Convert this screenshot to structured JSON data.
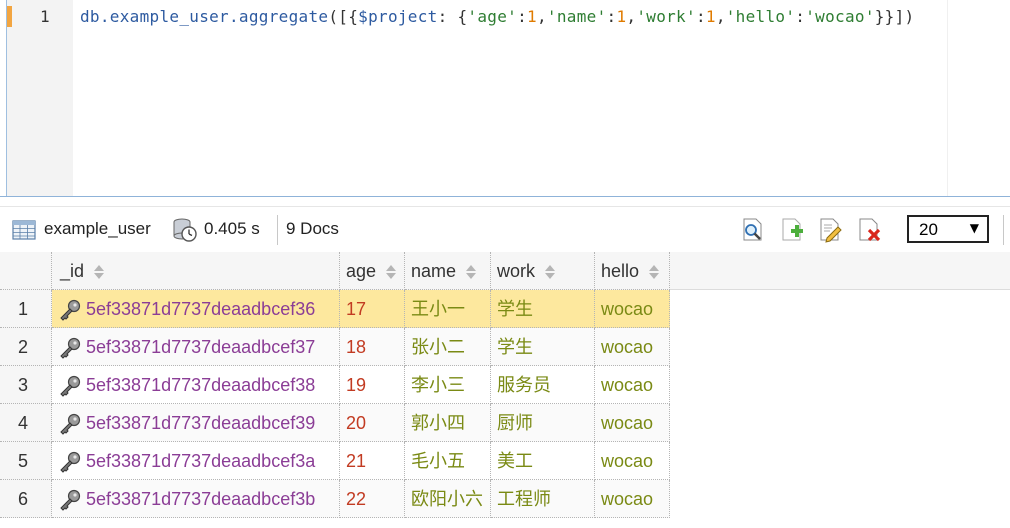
{
  "editor": {
    "line_number": "1",
    "code_tokens": [
      {
        "t": "db.example_user.aggregate",
        "c": "tk-default"
      },
      {
        "t": "([{",
        "c": "tk-punc"
      },
      {
        "t": "$project",
        "c": "tk-default"
      },
      {
        "t": ": {",
        "c": "tk-punc"
      },
      {
        "t": "'age'",
        "c": "tk-str"
      },
      {
        "t": ":",
        "c": "tk-punc"
      },
      {
        "t": "1",
        "c": "tk-num"
      },
      {
        "t": ",",
        "c": "tk-punc"
      },
      {
        "t": "'name'",
        "c": "tk-str"
      },
      {
        "t": ":",
        "c": "tk-punc"
      },
      {
        "t": "1",
        "c": "tk-num"
      },
      {
        "t": ",",
        "c": "tk-punc"
      },
      {
        "t": "'work'",
        "c": "tk-str"
      },
      {
        "t": ":",
        "c": "tk-punc"
      },
      {
        "t": "1",
        "c": "tk-num"
      },
      {
        "t": ",",
        "c": "tk-punc"
      },
      {
        "t": "'hello'",
        "c": "tk-str"
      },
      {
        "t": ":",
        "c": "tk-punc"
      },
      {
        "t": "'wocao'",
        "c": "tk-str"
      },
      {
        "t": "}}])",
        "c": "tk-punc"
      }
    ]
  },
  "toolbar": {
    "collection": "example_user",
    "time": "0.405 s",
    "docs": "9 Docs",
    "page_size": "20",
    "icons": [
      "table-icon",
      "timer-icon",
      "find-icon",
      "add-document-icon",
      "edit-document-icon",
      "delete-document-icon"
    ]
  },
  "grid": {
    "headers": {
      "id": "_id",
      "age": "age",
      "name": "name",
      "work": "work",
      "hello": "hello"
    },
    "rows": [
      {
        "num": "1",
        "id": "5ef33871d7737deaadbcef36",
        "age": "17",
        "name": "王小一",
        "work": "学生",
        "hello": "wocao"
      },
      {
        "num": "2",
        "id": "5ef33871d7737deaadbcef37",
        "age": "18",
        "name": "张小二",
        "work": "学生",
        "hello": "wocao"
      },
      {
        "num": "3",
        "id": "5ef33871d7737deaadbcef38",
        "age": "19",
        "name": "李小三",
        "work": "服务员",
        "hello": "wocao"
      },
      {
        "num": "4",
        "id": "5ef33871d7737deaadbcef39",
        "age": "20",
        "name": "郭小四",
        "work": "厨师",
        "hello": "wocao"
      },
      {
        "num": "5",
        "id": "5ef33871d7737deaadbcef3a",
        "age": "21",
        "name": "毛小五",
        "work": "美工",
        "hello": "wocao"
      },
      {
        "num": "6",
        "id": "5ef33871d7737deaadbcef3b",
        "age": "22",
        "name": "欧阳小六",
        "work": "工程师",
        "hello": "wocao"
      }
    ],
    "selected_row": 0
  },
  "colors": {
    "selected_row": "#fde89e",
    "id_text": "#8b3d96",
    "age_text": "#c23b22",
    "string_text": "#7a8a14",
    "gutter_marker": "#f2a541"
  }
}
